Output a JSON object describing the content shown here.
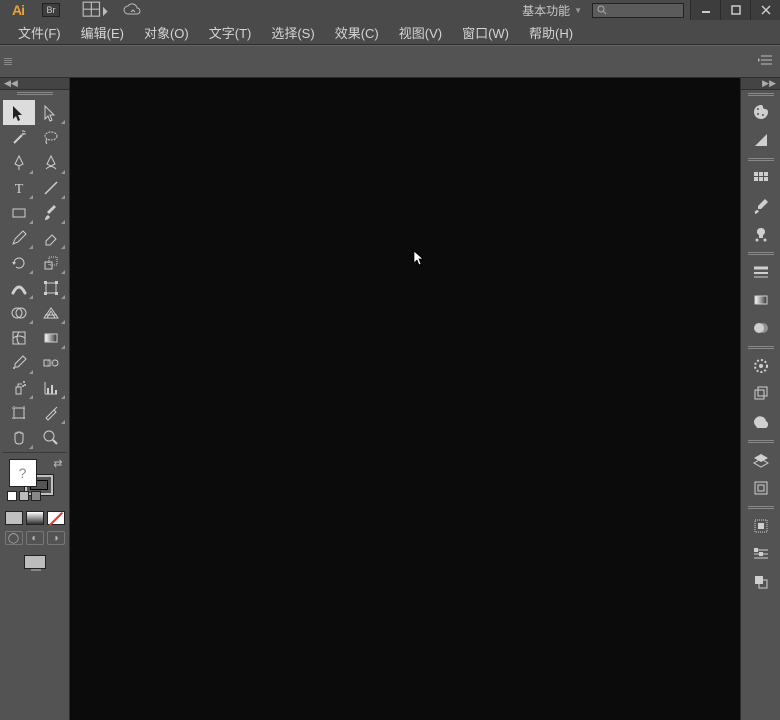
{
  "app": {
    "logo_text": "Ai",
    "bridge_badge": "Br"
  },
  "workspace": {
    "label": "基本功能"
  },
  "search": {
    "placeholder": ""
  },
  "menu": {
    "file": "文件(F)",
    "edit": "编辑(E)",
    "object": "对象(O)",
    "type": "文字(T)",
    "select": "选择(S)",
    "effect": "效果(C)",
    "view": "视图(V)",
    "window": "窗口(W)",
    "help": "帮助(H)"
  },
  "tools": {
    "selection": "选择工具",
    "direct_select": "直接选择工具",
    "magic_wand": "魔棒工具",
    "lasso": "套索工具",
    "pen": "钢笔工具",
    "curvature": "曲率工具",
    "text": "文字工具",
    "line": "线段工具",
    "rectangle": "矩形工具",
    "paintbrush": "画笔工具",
    "pencil": "铅笔工具",
    "eraser": "橡皮擦工具",
    "rotate": "旋转工具",
    "scale": "缩放工具",
    "width": "宽度工具",
    "free_transform": "自由变换工具",
    "shape_builder": "形状生成器工具",
    "perspective": "透视网格工具",
    "mesh": "网格工具",
    "gradient": "渐变工具",
    "eyedropper": "吸管工具",
    "blend": "混合工具",
    "symbol_sprayer": "符号喷枪工具",
    "column_graph": "柱形图工具",
    "artboard": "画板工具",
    "slice": "切片工具",
    "hand": "抓手工具",
    "zoom": "缩放工具",
    "fill_placeholder": "?"
  },
  "right_panels": {
    "color": "颜色",
    "color_guide": "颜色参考",
    "swatches": "色板",
    "brushes": "画笔",
    "symbols": "符号",
    "stroke": "描边",
    "gradient": "渐变",
    "transparency": "透明度",
    "appearance": "外观",
    "graphic_styles": "图形样式",
    "libraries": "库",
    "layers": "图层",
    "artboards": "画板",
    "align": "对齐",
    "transform": "变换",
    "pathfinder": "路径查找器"
  },
  "colors": {
    "accent": "#e8a33a",
    "ui_bg": "#535353",
    "dark_bg": "#0b0b0b"
  }
}
